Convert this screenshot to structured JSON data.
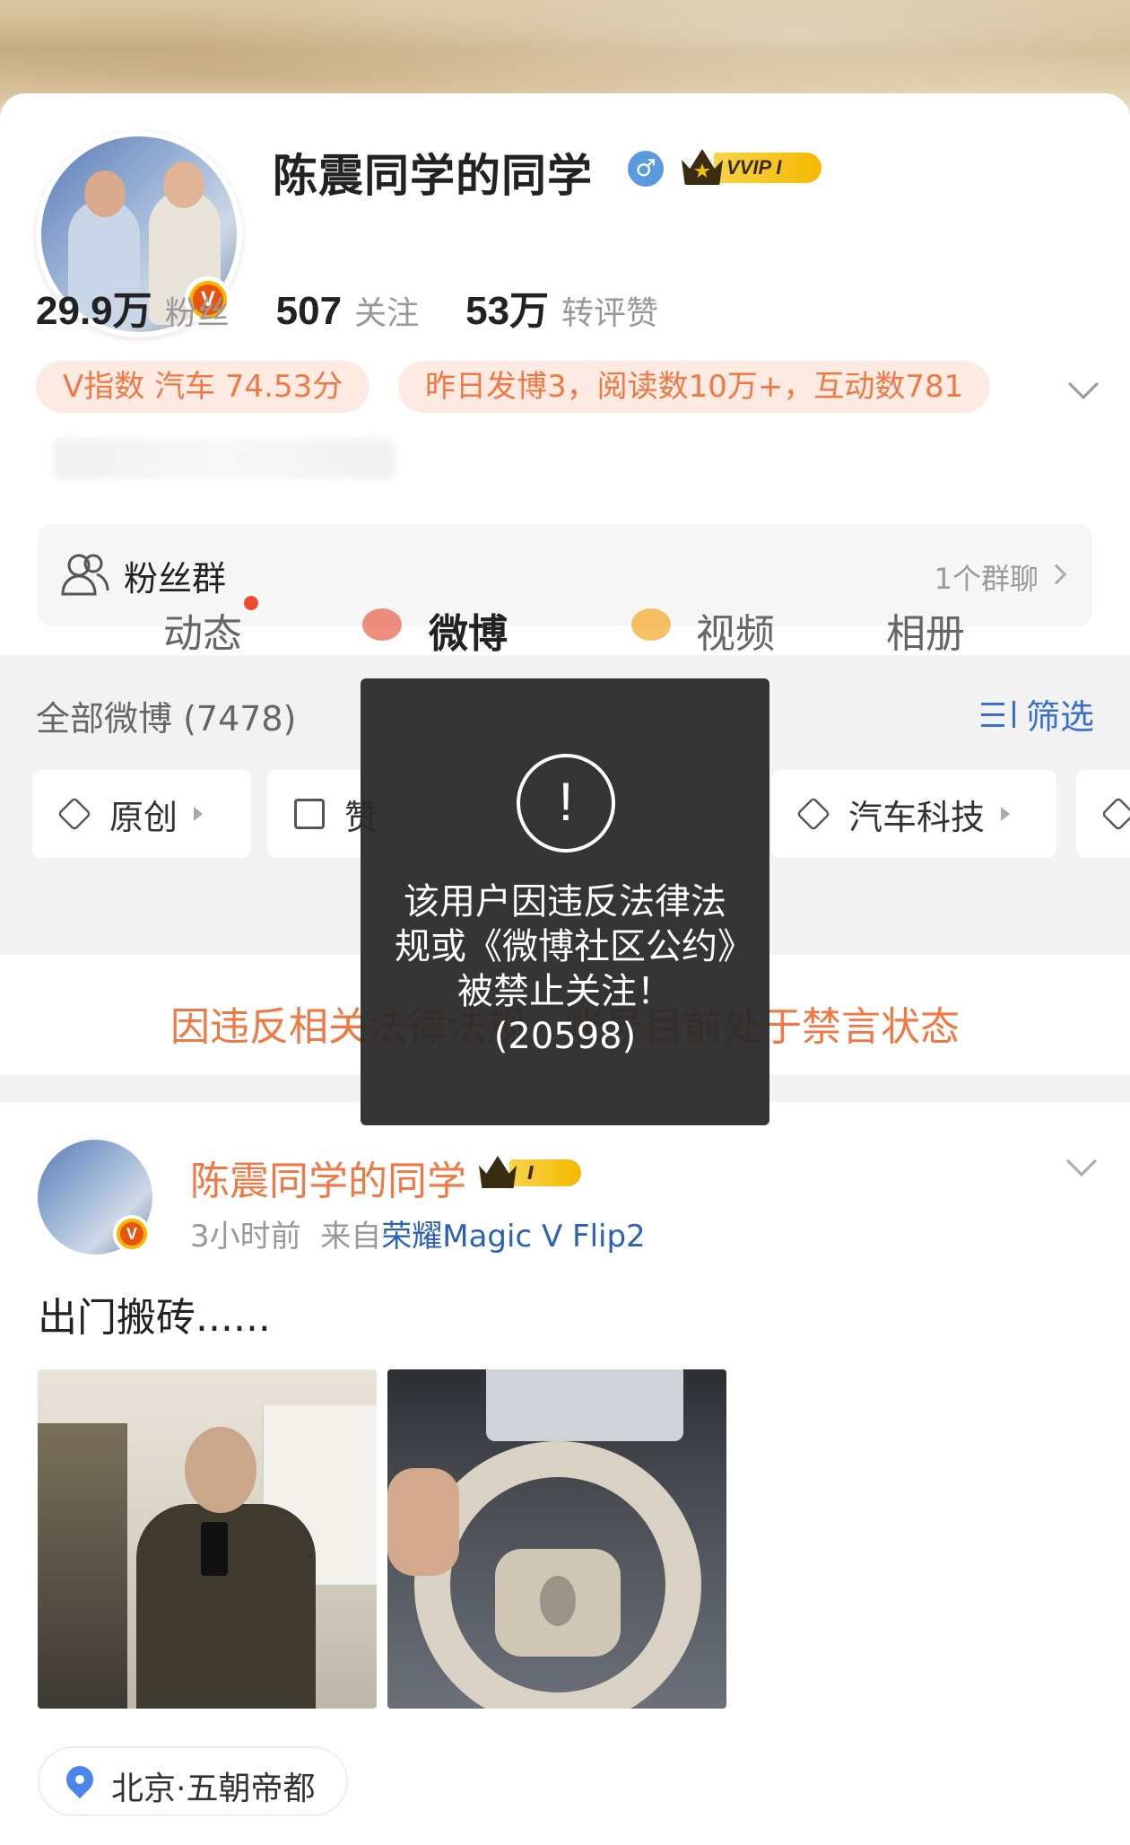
{
  "profile": {
    "name": "陈震同学的同学",
    "gender_symbol": "♂",
    "vip_label": "VVIP I",
    "verified_mark": "V"
  },
  "stats": [
    {
      "value": "29.9万",
      "label": "粉丝"
    },
    {
      "value": "507",
      "label": "关注"
    },
    {
      "value": "53万",
      "label": "转评赞"
    }
  ],
  "pills": {
    "v_index": "V指数 汽车 74.53分",
    "yesterday": "昨日发博3，阅读数10万+，互动数781"
  },
  "fan_group": {
    "label": "粉丝群",
    "count": "1个群聊"
  },
  "tabs": [
    {
      "label": "动态"
    },
    {
      "label": "微博"
    },
    {
      "label": "视频"
    },
    {
      "label": "相册"
    }
  ],
  "feed_header": {
    "all_label": "全部微博 (7478)",
    "filter_label": "筛选"
  },
  "chips": [
    {
      "label": "原创"
    },
    {
      "label": "赞"
    },
    {
      "label": "汽车科技"
    }
  ],
  "notice": "因违反相关法律法规，账号目前处于禁言状态",
  "toast": {
    "icon": "!",
    "message": "该用户因违反法律法规或《微博社区公约》被禁止关注！(20598)"
  },
  "post": {
    "author": "陈震同学的同学",
    "vip_label": "I",
    "time": "3小时前",
    "source_prefix": "来自",
    "source": "荣耀Magic V Flip2",
    "text": "出门搬砖......",
    "location": "北京·五朝帝都"
  },
  "colors": {
    "accent_orange": "#f07843",
    "link_blue": "#2b62b8",
    "filter_blue": "#3a6fd0",
    "tab_underline": "#f5a623"
  }
}
